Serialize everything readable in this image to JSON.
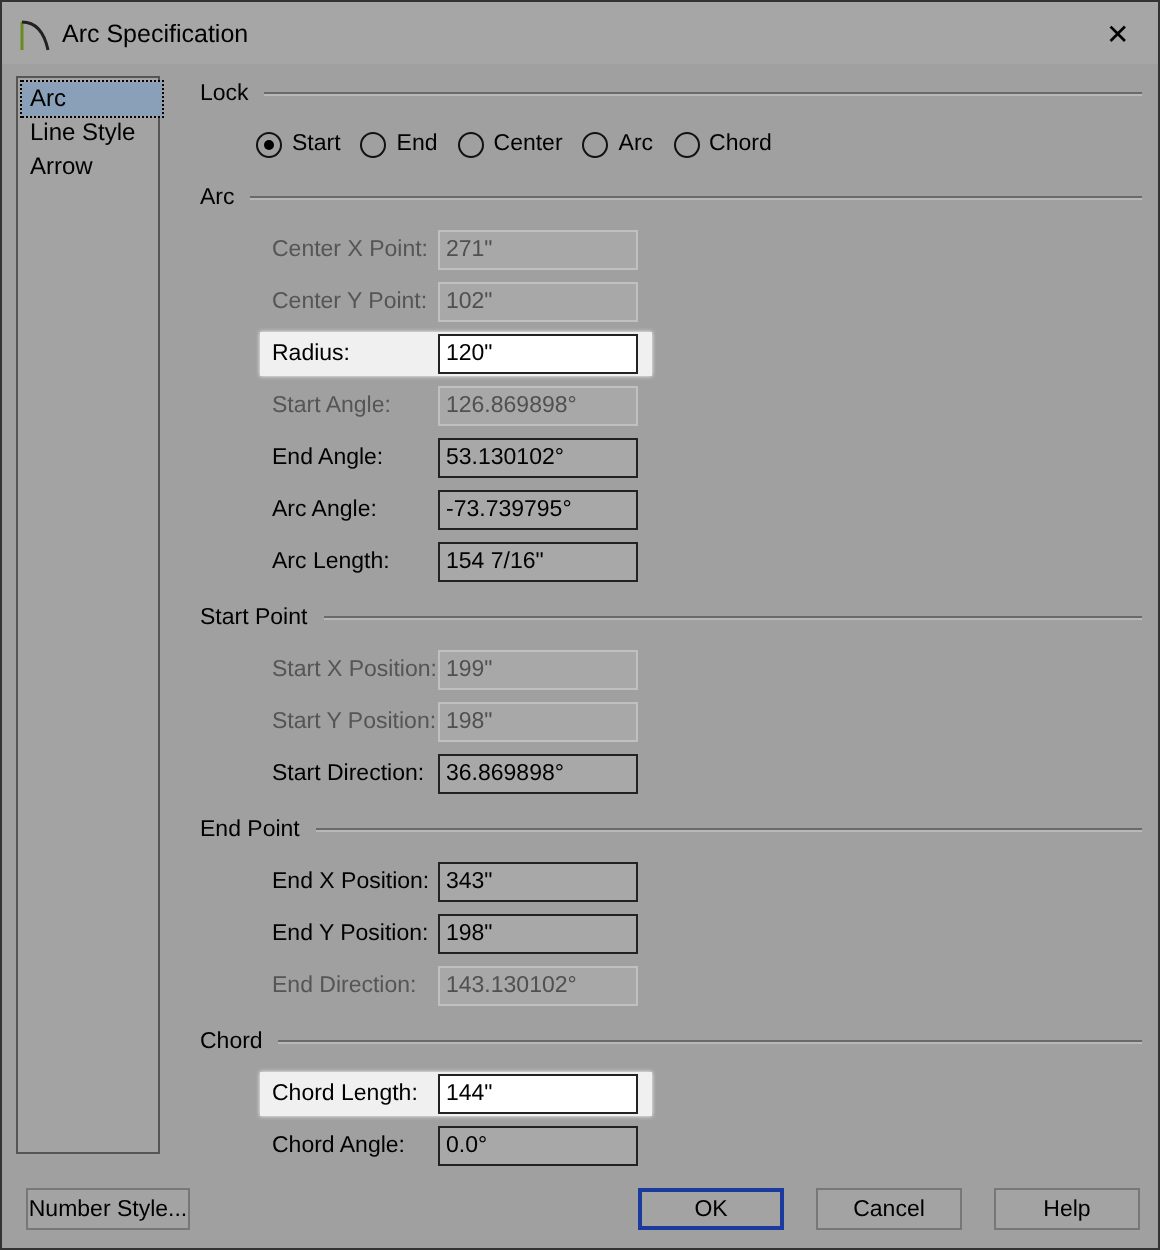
{
  "window": {
    "title": "Arc Specification",
    "close": "✕"
  },
  "sidebar": {
    "items": [
      {
        "label": "Arc",
        "selected": true
      },
      {
        "label": "Line Style",
        "selected": false
      },
      {
        "label": "Arrow",
        "selected": false
      }
    ]
  },
  "sections": [
    {
      "title": "Lock",
      "kind": "radios",
      "options": [
        {
          "label": "Start",
          "selected": true
        },
        {
          "label": "End",
          "selected": false
        },
        {
          "label": "Center",
          "selected": false
        },
        {
          "label": "Arc",
          "selected": false
        },
        {
          "label": "Chord",
          "selected": false
        }
      ]
    },
    {
      "title": "Arc",
      "kind": "fields",
      "fields": [
        {
          "label": "Center X Point:",
          "value": "271\"",
          "disabled": true,
          "highlighted": false
        },
        {
          "label": "Center Y Point:",
          "value": "102\"",
          "disabled": true,
          "highlighted": false
        },
        {
          "label": "Radius:",
          "value": "120\"",
          "disabled": false,
          "highlighted": true
        },
        {
          "label": "Start Angle:",
          "value": "126.869898°",
          "disabled": true,
          "highlighted": false
        },
        {
          "label": "End Angle:",
          "value": "53.130102°",
          "disabled": false,
          "highlighted": false
        },
        {
          "label": "Arc Angle:",
          "value": "-73.739795°",
          "disabled": false,
          "highlighted": false
        },
        {
          "label": "Arc Length:",
          "value": "154 7/16\"",
          "disabled": false,
          "highlighted": false
        }
      ]
    },
    {
      "title": "Start Point",
      "kind": "fields",
      "fields": [
        {
          "label": "Start X Position:",
          "value": "199\"",
          "disabled": true,
          "highlighted": false
        },
        {
          "label": "Start Y Position:",
          "value": "198\"",
          "disabled": true,
          "highlighted": false
        },
        {
          "label": "Start Direction:",
          "value": "36.869898°",
          "disabled": false,
          "highlighted": false
        }
      ]
    },
    {
      "title": "End Point",
      "kind": "fields",
      "fields": [
        {
          "label": "End X Position:",
          "value": "343\"",
          "disabled": false,
          "highlighted": false
        },
        {
          "label": "End Y Position:",
          "value": "198\"",
          "disabled": false,
          "highlighted": false
        },
        {
          "label": "End Direction:",
          "value": "143.130102°",
          "disabled": true,
          "highlighted": false
        }
      ]
    },
    {
      "title": "Chord",
      "kind": "fields",
      "fields": [
        {
          "label": "Chord Length:",
          "value": "144\"",
          "disabled": false,
          "highlighted": true
        },
        {
          "label": "Chord Angle:",
          "value": "0.0°",
          "disabled": false,
          "highlighted": false
        }
      ]
    }
  ],
  "buttons": [
    {
      "label": "Number Style...",
      "default": false
    },
    {
      "label": "OK",
      "default": true
    },
    {
      "label": "Cancel",
      "default": false
    },
    {
      "label": "Help",
      "default": false
    }
  ]
}
